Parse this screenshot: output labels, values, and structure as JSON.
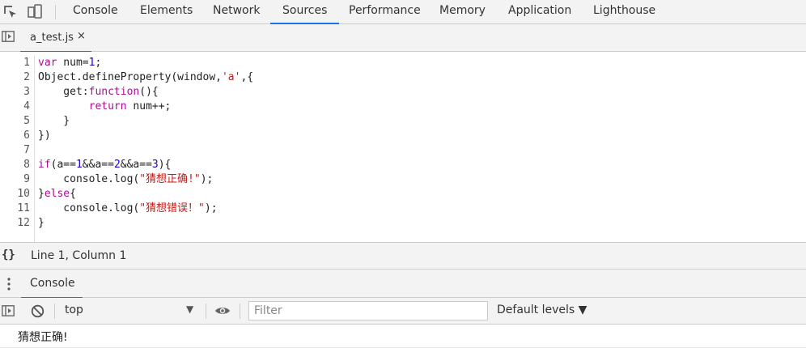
{
  "topbar": {
    "tabs": [
      "Console",
      "Elements",
      "Network",
      "Sources",
      "Performance",
      "Memory",
      "Application",
      "Lighthouse"
    ],
    "active_tab": "Sources"
  },
  "editor": {
    "file_tab": {
      "name": "a_test.js",
      "close_glyph": "×"
    },
    "lines": [
      {
        "n": "1",
        "html": "<span class='kw'>var</span> num=<span class='num'>1</span>;"
      },
      {
        "n": "2",
        "html": "Object.defineProperty(window,<span class='str'>'a'</span>,{"
      },
      {
        "n": "3",
        "html": "    get:<span class='kw'>function</span>(){"
      },
      {
        "n": "4",
        "html": "        <span class='kw'>return</span> num++;"
      },
      {
        "n": "5",
        "html": "    }"
      },
      {
        "n": "6",
        "html": "})"
      },
      {
        "n": "7",
        "html": ""
      },
      {
        "n": "8",
        "html": "<span class='kw'>if</span>(a==<span class='num'>1</span>&amp;&amp;a==<span class='num'>2</span>&amp;&amp;a==<span class='num'>3</span>){"
      },
      {
        "n": "9",
        "html": "    console.log(<span class='str'>\"猜想正确!\"</span>);"
      },
      {
        "n": "10",
        "html": "}<span class='kw'>else</span>{"
      },
      {
        "n": "11",
        "html": "    console.log(<span class='str'>\"猜想错误！\"</span>);"
      },
      {
        "n": "12",
        "html": "}"
      }
    ]
  },
  "status": {
    "braces": "{}",
    "position": "Line 1, Column 1"
  },
  "drawer": {
    "tab_label": "Console"
  },
  "console_toolbar": {
    "context": "top",
    "context_arrow": "▼",
    "filter_placeholder": "Filter",
    "levels": "Default levels ▼"
  },
  "console_output": {
    "message": "猜想正确!"
  },
  "colors": {
    "accent": "#1a73e8",
    "keyword": "#aa0d91",
    "string": "#c41a16",
    "number": "#1c00cf"
  }
}
